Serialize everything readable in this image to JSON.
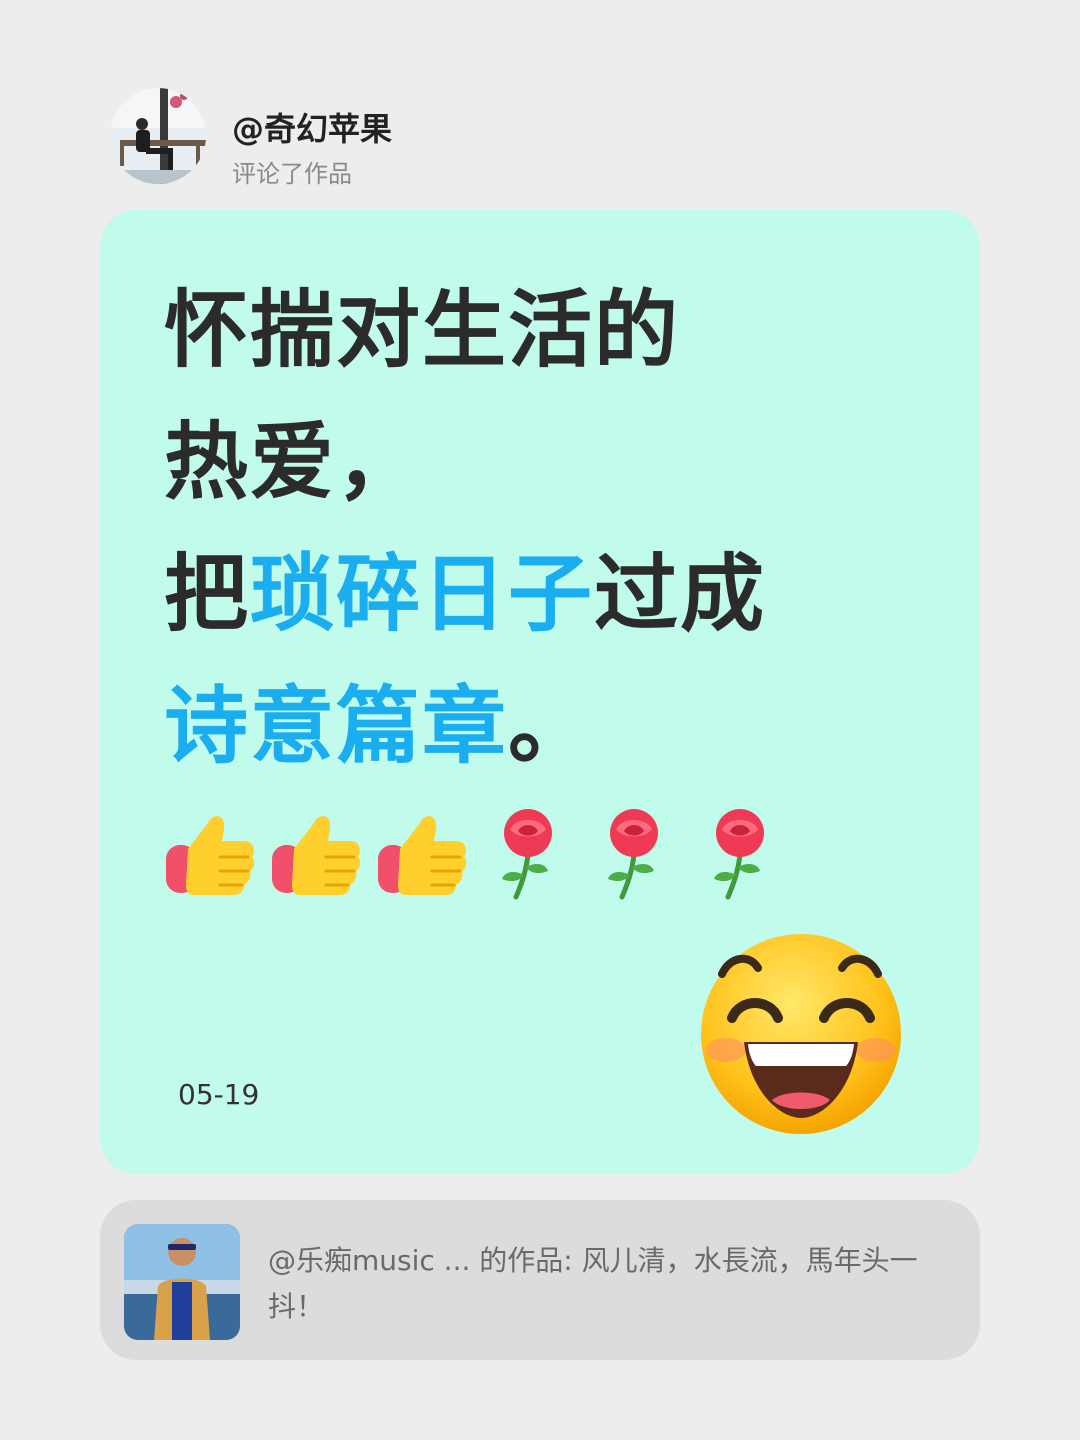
{
  "header": {
    "username": "@奇幻苹果",
    "action": "评论了作品"
  },
  "comment": {
    "lines": [
      [
        {
          "text": "怀揣对生活的",
          "highlight": false
        }
      ],
      [
        {
          "text": "热爱，",
          "highlight": false
        }
      ],
      [
        {
          "text": "把",
          "highlight": false
        },
        {
          "text": "琐碎日子",
          "highlight": true
        },
        {
          "text": "过成",
          "highlight": false
        }
      ],
      [
        {
          "text": "诗意篇章",
          "highlight": true
        },
        {
          "text": "。",
          "highlight": false
        }
      ]
    ],
    "emojis": [
      "thumbs-up",
      "thumbs-up",
      "thumbs-up",
      "rose",
      "rose",
      "rose"
    ],
    "sticker": "grinning-face",
    "date": "05-19"
  },
  "source": {
    "text": "@乐痴music ... 的作品: 风儿清，水長流，馬年头一抖！"
  },
  "colors": {
    "page_bg": "#ededed",
    "card_bg": "#c1fbeb",
    "highlight": "#1aaef0",
    "text_dark": "#2b2b2b",
    "source_bg": "#dcdcdc"
  }
}
